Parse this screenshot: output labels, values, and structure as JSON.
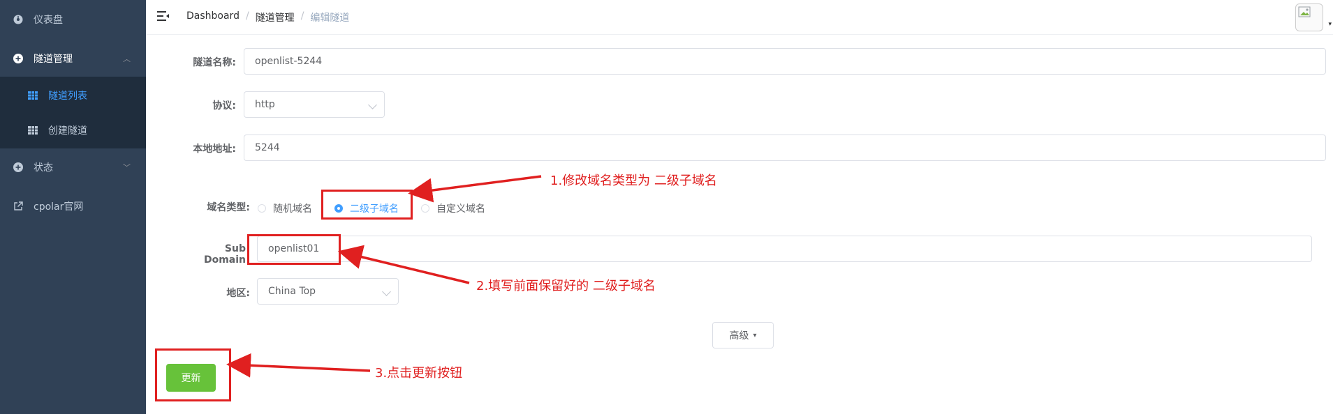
{
  "sidebar": {
    "items": [
      {
        "label": "仪表盘",
        "icon": "dashboard-icon"
      },
      {
        "label": "隧道管理",
        "icon": "plus-circle-icon",
        "arrow": "︿"
      },
      {
        "label": "状态",
        "icon": "plus-circle-icon",
        "arrow": "﹀"
      },
      {
        "label": "cpolar官网",
        "icon": "external-link-icon"
      }
    ],
    "sub_items": [
      {
        "label": "隧道列表",
        "icon": "table-icon",
        "active": true
      },
      {
        "label": "创建隧道",
        "icon": "table-icon"
      }
    ]
  },
  "header": {
    "breadcrumb": [
      "Dashboard",
      "隧道管理",
      "编辑隧道"
    ],
    "separator": "/",
    "avatar_caret": "▾"
  },
  "form": {
    "tunnel_name_label": "隧道名称:",
    "tunnel_name_value": "openlist-5244",
    "protocol_label": "协议:",
    "protocol_value": "http",
    "local_addr_label": "本地地址:",
    "local_addr_value": "5244",
    "domain_type_label": "域名类型:",
    "domain_type_options": [
      "随机域名",
      "二级子域名",
      "自定义域名"
    ],
    "domain_type_selected": "二级子域名",
    "subdomain_label": "Sub Domain",
    "subdomain_value": "openlist01",
    "region_label": "地区:",
    "region_value": "China Top",
    "advanced_label": "高级",
    "advanced_caret": "▾",
    "update_label": "更新"
  },
  "annotations": {
    "step1": "1.修改域名类型为 二级子域名",
    "step2": "2.填写前面保留好的 二级子域名",
    "step3": "3.点击更新按钮",
    "color": "#e02020"
  },
  "colors": {
    "sidebar_bg": "#304156",
    "submenu_bg": "#1f2d3d",
    "accent": "#409eff",
    "success": "#67c23a"
  }
}
